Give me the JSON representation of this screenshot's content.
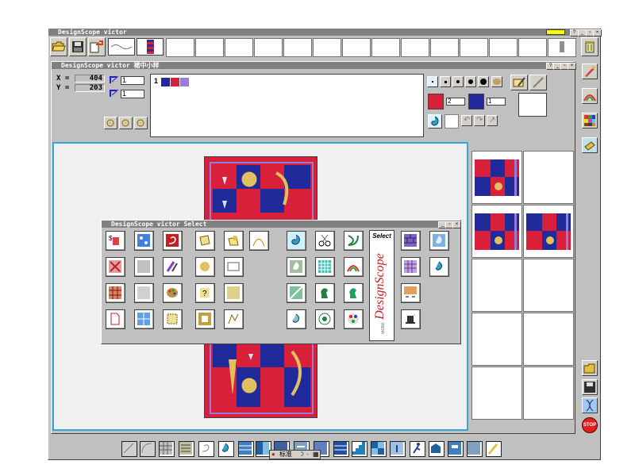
{
  "app_title": "DesignScope victor",
  "toolbar": {
    "open_icon": "folder-open-icon",
    "save_icon": "floppy-disk-icon",
    "export_icon": "export-icon",
    "trash_icon": "trash-icon"
  },
  "inner_window": {
    "title": "DesignScope victor 裙中小样"
  },
  "coords": {
    "x_label": "X =",
    "x_value": "404",
    "y_label": "Y =",
    "y_value": "203"
  },
  "repeat": {
    "h_value": "1",
    "v_value": "1"
  },
  "color_row": {
    "index": "1"
  },
  "colors": {
    "primary_count": "2",
    "secondary_count": "1",
    "red": "#d8203a",
    "blue": "#202a9a",
    "purple": "#9a7ad8",
    "canvas_frame": "#30a8d8"
  },
  "select_palette": {
    "title": "DesignScope victor Select",
    "brand_header": "Select",
    "brand_name": "DesignScope",
    "brand_sub": "victor"
  },
  "taskbar": {
    "ime_label": "标准"
  },
  "stop_label": "STOP"
}
